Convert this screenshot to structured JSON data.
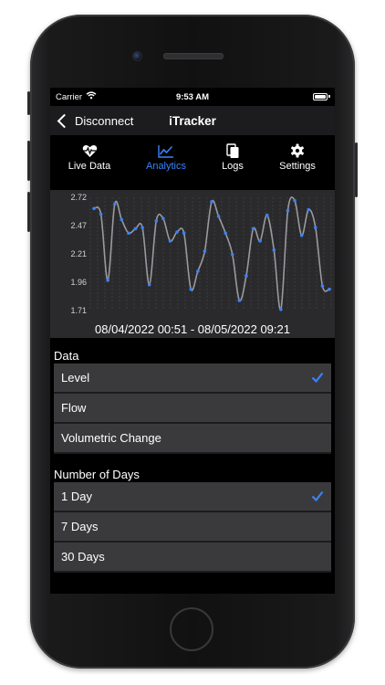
{
  "status_bar": {
    "carrier": "Carrier",
    "time": "9:53 AM"
  },
  "nav": {
    "back_label": "Disconnect",
    "title": "iTracker"
  },
  "tabs": [
    {
      "label": "Live Data",
      "icon": "heart-pulse-icon",
      "active": false
    },
    {
      "label": "Analytics",
      "icon": "line-chart-icon",
      "active": true
    },
    {
      "label": "Logs",
      "icon": "document-icon",
      "active": false
    },
    {
      "label": "Settings",
      "icon": "gear-icon",
      "active": false
    }
  ],
  "chart_data": {
    "type": "line",
    "y_ticks": [
      "2.72",
      "2.47",
      "2.21",
      "1.96",
      "1.71"
    ],
    "ylim": [
      1.71,
      2.72
    ],
    "x_range_label": "08/04/2022 00:51 - 08/05/2022 09:21",
    "series": [
      {
        "values": [
          2.62,
          2.57,
          1.98,
          2.66,
          2.52,
          2.4,
          2.44,
          2.45,
          1.94,
          2.51,
          2.53,
          2.33,
          2.41,
          2.4,
          1.9,
          2.06,
          2.24,
          2.68,
          2.55,
          2.4,
          2.21,
          1.8,
          2.02,
          2.44,
          2.33,
          2.56,
          2.25,
          1.72,
          2.6,
          2.69,
          2.38,
          2.61,
          2.45,
          1.93,
          1.9
        ]
      }
    ],
    "colors": {
      "line": "#9a9a9e",
      "point": "#3a82f7",
      "background": "#2a2a2c",
      "grid": "#4a4a4e"
    }
  },
  "data_section": {
    "title": "Data",
    "options": [
      {
        "label": "Level",
        "selected": true
      },
      {
        "label": "Flow",
        "selected": false
      },
      {
        "label": "Volumetric Change",
        "selected": false
      }
    ]
  },
  "days_section": {
    "title": "Number of Days",
    "options": [
      {
        "label": "1 Day",
        "selected": true
      },
      {
        "label": "7 Days",
        "selected": false
      },
      {
        "label": "30 Days",
        "selected": false
      }
    ]
  },
  "accent_color": "#3a82f7"
}
